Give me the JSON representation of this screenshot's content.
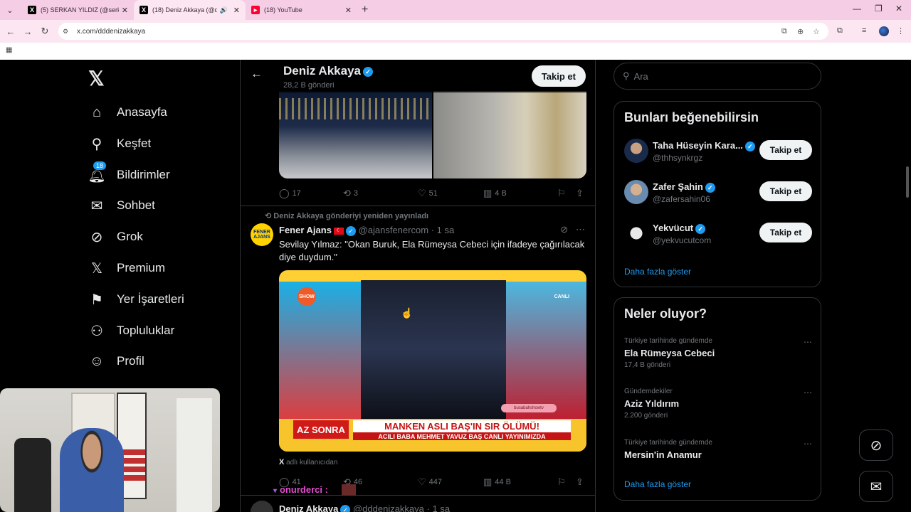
{
  "browser": {
    "tabs": [
      {
        "label": "(5) SERKAN YILDIZ (@serkan80...",
        "favicon": "x-icon",
        "active": false
      },
      {
        "label": "(18) Deniz Akkaya (@ddden...",
        "favicon": "x-icon",
        "active": true
      },
      {
        "label": "(18) YouTube",
        "favicon": "youtube-icon",
        "active": false
      }
    ],
    "url": "x.com/dddenizakkaya"
  },
  "nav": {
    "items": [
      {
        "label": "Anasayfa",
        "icon": "home-icon"
      },
      {
        "label": "Keşfet",
        "icon": "search-icon"
      },
      {
        "label": "Bildirimler",
        "icon": "bell-icon",
        "badge": "18"
      },
      {
        "label": "Sohbet",
        "icon": "mail-icon"
      },
      {
        "label": "Grok",
        "icon": "grok-icon"
      },
      {
        "label": "Premium",
        "icon": "x-icon"
      },
      {
        "label": "Yer İşaretleri",
        "icon": "bookmark-icon"
      },
      {
        "label": "Topluluklar",
        "icon": "communities-icon"
      },
      {
        "label": "Profil",
        "icon": "profile-icon"
      }
    ]
  },
  "profile": {
    "name": "Deniz Akkaya",
    "posts_count": "28,2 B gönderi",
    "follow_label": "Takip et"
  },
  "post1": {
    "replies": "17",
    "reposts": "3",
    "likes": "51",
    "views": "4 B"
  },
  "post2": {
    "repost_by": "Deniz Akkaya gönderiyi yeniden yayınladı",
    "author": "Fener Ajans",
    "handle": "@ajansfenercom",
    "time": "· 1 sa",
    "text": "Sevilay Yılmaz: \"Okan Buruk, Ela Rümeysa Cebeci için ifadeye çağırılacak diye duydum.\"",
    "avatar_text": "FENER AJANS",
    "video": {
      "channel": "SHOW",
      "live": "CANLI",
      "tag": "AZ SONRA",
      "headline": "MANKEN ASLI BAŞ'IN SIR ÖLÜMÜ!",
      "subline": "ACILI BABA MEHMET YAVUZ BAŞ CANLI YAYINIMIZDA",
      "url": "busabahshowtv"
    },
    "from_user": "adlı kullanıcıdan",
    "from_user_brand": "X",
    "replies": "41",
    "reposts": "46",
    "likes": "447",
    "views": "44 B"
  },
  "post3": {
    "author": "Deniz Akkaya",
    "handle": "@dddenizakkaya",
    "time": "· 1 sa"
  },
  "search": {
    "placeholder": "Ara"
  },
  "suggestions": {
    "title": "Bunları beğenebilirsin",
    "items": [
      {
        "name": "Taha Hüseyin Kara...",
        "handle": "@thhsynkrgz",
        "follow": "Takip et"
      },
      {
        "name": "Zafer Şahin",
        "handle": "@zafersahin06",
        "follow": "Takip et"
      },
      {
        "name": "Yekvücut",
        "handle": "@yekvucutcom",
        "follow": "Takip et"
      }
    ],
    "more": "Daha fazla göster"
  },
  "trends": {
    "title": "Neler oluyor?",
    "items": [
      {
        "context": "Türkiye tarihinde gündemde",
        "topic": "Ela Rümeysa Cebeci",
        "count": "17,4 B gönderi"
      },
      {
        "context": "Gündemdekiler",
        "topic": "Aziz Yıldırım",
        "count": "2.200 gönderi"
      },
      {
        "context": "Türkiye tarihinde gündemde",
        "topic": "Mersin'in Anamur",
        "count": ""
      }
    ],
    "more": "Daha fazla göster"
  },
  "overlay": {
    "chat_user": "onurderci :"
  },
  "colors": {
    "accent": "#1d9bf0",
    "background": "#000000",
    "tabstrip": "#f5cde4"
  }
}
